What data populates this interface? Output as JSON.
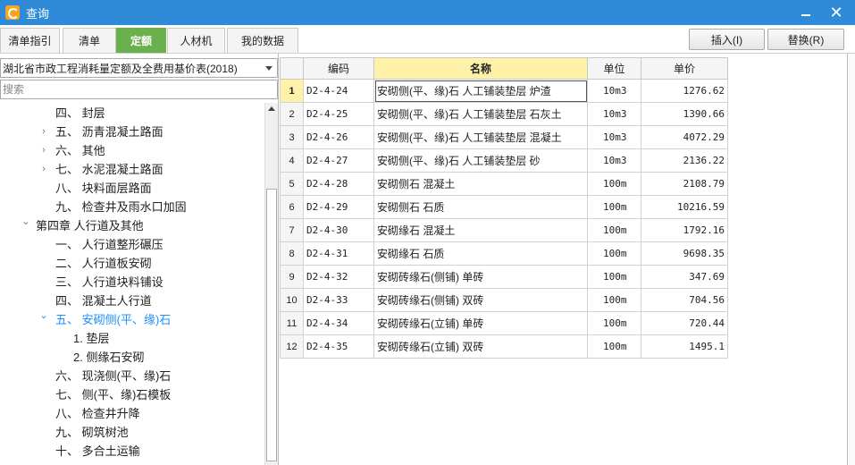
{
  "window": {
    "title": "查询"
  },
  "tabs": [
    {
      "label": "清单指引",
      "active": false
    },
    {
      "label": "清单",
      "active": false
    },
    {
      "label": "定额",
      "active": true
    },
    {
      "label": "人材机",
      "active": false
    },
    {
      "label": "我的数据",
      "active": false
    }
  ],
  "actions": {
    "insert_label": "插入(I)",
    "replace_label": "替换(R)"
  },
  "left_panel": {
    "library": "湖北省市政工程消耗量定额及全费用基价表(2018)",
    "search_placeholder": "搜索",
    "tree": [
      {
        "label": "四、 封层",
        "caret": "",
        "level": 2,
        "active": false
      },
      {
        "label": "五、 沥青混凝土路面",
        "caret": "right",
        "level": 2,
        "active": false
      },
      {
        "label": "六、 其他",
        "caret": "right",
        "level": 2,
        "active": false
      },
      {
        "label": "七、 水泥混凝土路面",
        "caret": "right",
        "level": 2,
        "active": false
      },
      {
        "label": "八、 块料面层路面",
        "caret": "",
        "level": 2,
        "active": false
      },
      {
        "label": "九、 检查井及雨水口加固",
        "caret": "",
        "level": 2,
        "active": false
      },
      {
        "label": "第四章 人行道及其他",
        "caret": "down",
        "level": 1,
        "active": false
      },
      {
        "label": "一、 人行道整形碾压",
        "caret": "",
        "level": 2,
        "active": false
      },
      {
        "label": "二、 人行道板安砌",
        "caret": "",
        "level": 2,
        "active": false
      },
      {
        "label": "三、 人行道块料铺设",
        "caret": "",
        "level": 2,
        "active": false
      },
      {
        "label": "四、 混凝土人行道",
        "caret": "",
        "level": 2,
        "active": false
      },
      {
        "label": "五、 安砌侧(平、缘)石",
        "caret": "down",
        "level": 2,
        "active": true
      },
      {
        "label": "1. 垫层",
        "caret": "",
        "level": 3,
        "active": false
      },
      {
        "label": "2. 侧缘石安砌",
        "caret": "",
        "level": 3,
        "active": false
      },
      {
        "label": "六、 现浇侧(平、缘)石",
        "caret": "",
        "level": 2,
        "active": false
      },
      {
        "label": "七、 侧(平、缘)石模板",
        "caret": "",
        "level": 2,
        "active": false
      },
      {
        "label": "八、 检查井升降",
        "caret": "",
        "level": 2,
        "active": false
      },
      {
        "label": "九、 砌筑树池",
        "caret": "",
        "level": 2,
        "active": false
      },
      {
        "label": "十、 多合土运输",
        "caret": "",
        "level": 2,
        "active": false
      }
    ]
  },
  "grid": {
    "headers": {
      "code": "编码",
      "name": "名称",
      "unit": "单位",
      "price": "单价"
    },
    "selected_row": 0,
    "rows": [
      {
        "idx": "1",
        "code": "D2-4-24",
        "name": "安砌侧(平、缘)石 人工铺装垫层 炉渣",
        "unit": "10m3",
        "price": "1276.62"
      },
      {
        "idx": "2",
        "code": "D2-4-25",
        "name": "安砌侧(平、缘)石 人工铺装垫层 石灰土",
        "unit": "10m3",
        "price": "1390.66"
      },
      {
        "idx": "3",
        "code": "D2-4-26",
        "name": "安砌侧(平、缘)石 人工铺装垫层 混凝土",
        "unit": "10m3",
        "price": "4072.29"
      },
      {
        "idx": "4",
        "code": "D2-4-27",
        "name": "安砌侧(平、缘)石 人工铺装垫层 砂",
        "unit": "10m3",
        "price": "2136.22"
      },
      {
        "idx": "5",
        "code": "D2-4-28",
        "name": "安砌侧石 混凝土",
        "unit": "100m",
        "price": "2108.79"
      },
      {
        "idx": "6",
        "code": "D2-4-29",
        "name": "安砌侧石 石质",
        "unit": "100m",
        "price": "10216.59"
      },
      {
        "idx": "7",
        "code": "D2-4-30",
        "name": "安砌缘石 混凝土",
        "unit": "100m",
        "price": "1792.16"
      },
      {
        "idx": "8",
        "code": "D2-4-31",
        "name": "安砌缘石 石质",
        "unit": "100m",
        "price": "9698.35"
      },
      {
        "idx": "9",
        "code": "D2-4-32",
        "name": "安砌砖缘石(侧铺) 单砖",
        "unit": "100m",
        "price": "347.69"
      },
      {
        "idx": "10",
        "code": "D2-4-33",
        "name": "安砌砖缘石(侧铺) 双砖",
        "unit": "100m",
        "price": "704.56"
      },
      {
        "idx": "11",
        "code": "D2-4-34",
        "name": "安砌砖缘石(立铺) 单砖",
        "unit": "100m",
        "price": "720.44"
      },
      {
        "idx": "12",
        "code": "D2-4-35",
        "name": "安砌砖缘石(立铺) 双砖",
        "unit": "100m",
        "price": "1495.1"
      }
    ]
  },
  "colors": {
    "title_bar": "#2f8ad8",
    "active_tab": "#6ab04c",
    "selected_header": "#fff2a8",
    "tree_active": "#1e90ff"
  }
}
